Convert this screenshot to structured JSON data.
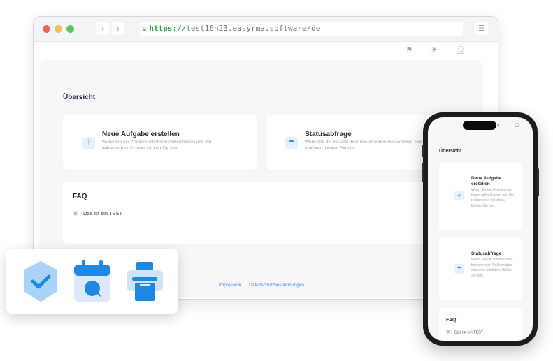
{
  "browser": {
    "url_protocol": "https://",
    "url_rest": "test16n23.easyrma.software/de",
    "window_dots": [
      "#ed6a5e",
      "#f5bf4f",
      "#61c554"
    ]
  },
  "page": {
    "heading": "Übersicht",
    "cards": [
      {
        "title": "Neue Aufgabe erstellen",
        "desc": "Wenn Sie ein Problem mit Ihrem Artikel haben und Ihn reklamieren möchten, klicken Sie hier.",
        "icon": "plus-box-icon"
      },
      {
        "title": "Statusabfrage",
        "desc": "Wenn Sie die Historie ihrer bestehenden Reklamation einsehen möchten, klicken Sie hier.",
        "icon": "umbrella-icon"
      }
    ],
    "faq": {
      "title": "FAQ",
      "items": [
        "Das ist ein TEST"
      ]
    },
    "footer": {
      "impressum": "Impressum",
      "datenschutz": "Datenschutzbestimmungen"
    }
  },
  "phone": {
    "heading": "Übersicht",
    "cards": [
      {
        "title": "Neue Aufgabe erstellen",
        "desc": "Wenn Sie ein Problem mit Ihrem Artikel haben und Ihn reklamieren möchten, klicken Sie hier."
      },
      {
        "title": "Statusabfrage",
        "desc": "Wenn Sie die Historie Ihrer bestehenden Reklamation einsehen möchten, klicken Sie hier."
      }
    ],
    "faq": {
      "title": "FAQ",
      "items": [
        "Das ist ein TEST"
      ]
    }
  },
  "colors": {
    "accent": "#3b82f6",
    "accent_light": "#dbe9fb",
    "accent_dark": "#1e88e5"
  }
}
